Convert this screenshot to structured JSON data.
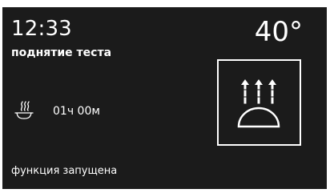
{
  "display": {
    "clock": "12:33",
    "program_name": "поднятие теста",
    "temperature": "40°",
    "timer": "01ч 00м",
    "status": "функция запущена"
  },
  "icons": {
    "timer_icon": "steaming-pot-icon",
    "mode_icon": "dough-rising-icon"
  },
  "colors": {
    "background": "#1b1b1b",
    "foreground": "#ffffff"
  }
}
